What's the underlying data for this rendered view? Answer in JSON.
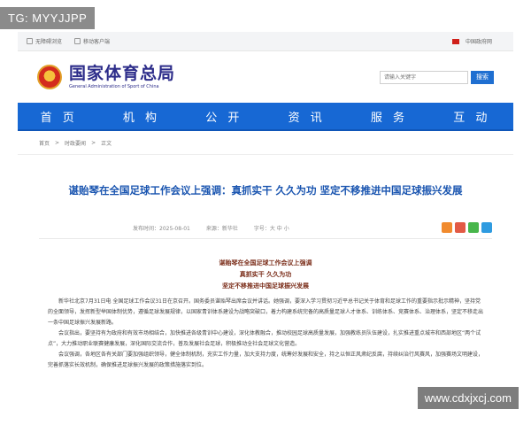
{
  "watermark_tg": "TG: MYYJJPP",
  "watermark_site": "www.cdxjxcj.com",
  "topbar": {
    "left_items": [
      "无障碍浏览",
      "移动客户端"
    ],
    "right_text": "中国政府网"
  },
  "header": {
    "title_cn": "国家体育总局",
    "title_en": "General Administration of Sport of China",
    "search_placeholder": "请输入关键字",
    "search_button": "搜索"
  },
  "nav": [
    "首 页",
    "机 构",
    "公 开",
    "资 讯",
    "服 务",
    "互 动"
  ],
  "breadcrumb": [
    "首页",
    ">",
    "时政要闻",
    ">",
    "正文"
  ],
  "article": {
    "title": "谌贻琴在全国足球工作会议上强调：真抓实干 久久为功 坚定不移推进中国足球振兴发展",
    "date": "发布时间：2025-08-01",
    "source": "来源：新华社",
    "font_size": "字号：大 中 小",
    "subhead1": "谌贻琴在全国足球工作会议上强调",
    "subhead2": "真抓实干 久久为功",
    "subhead3": "坚定不移推进中国足球振兴发展",
    "paragraphs": [
      "新华社北京7月31日电 全国足球工作会议31日在京召开。国务委员谌贻琴出席会议并讲话。她强调，要深入学习贯彻习近平总书记关于体育和足球工作的重要指示批示精神，坚持党的全面领导，发挥新型举国体制优势，遵循足球发展规律，以国家青训体系建设为战略突破口，着力构建系统完备的高质量足球人才体系、训练体系、竞赛体系、治理体系，坚定不移走出一条中国足球振兴发展新路。",
      "会议指出，要坚持有为政府和有效市场相结合，加快推进各级青训中心建设，深化体教融合，推动校园足球高质量发展，加强教练员队伍建设，扎实推进重点城市和西部地区“两个试点”，大力推动职业联赛健康发展，深化国际交流合作，普及发展社会足球，积极推动全社会足球文化营造。",
      "会议强调，各地区各有关部门要加强组织领导，健全体制机制，充实工作力量，加大支持力度，统筹好发展和安全，持之以恒正风肃纪反腐，持续纠治行风赛风，加强赛场文明建设，完善抓落实长效机制，确保推进足球振兴发展的政策措施落实到位。"
    ]
  }
}
